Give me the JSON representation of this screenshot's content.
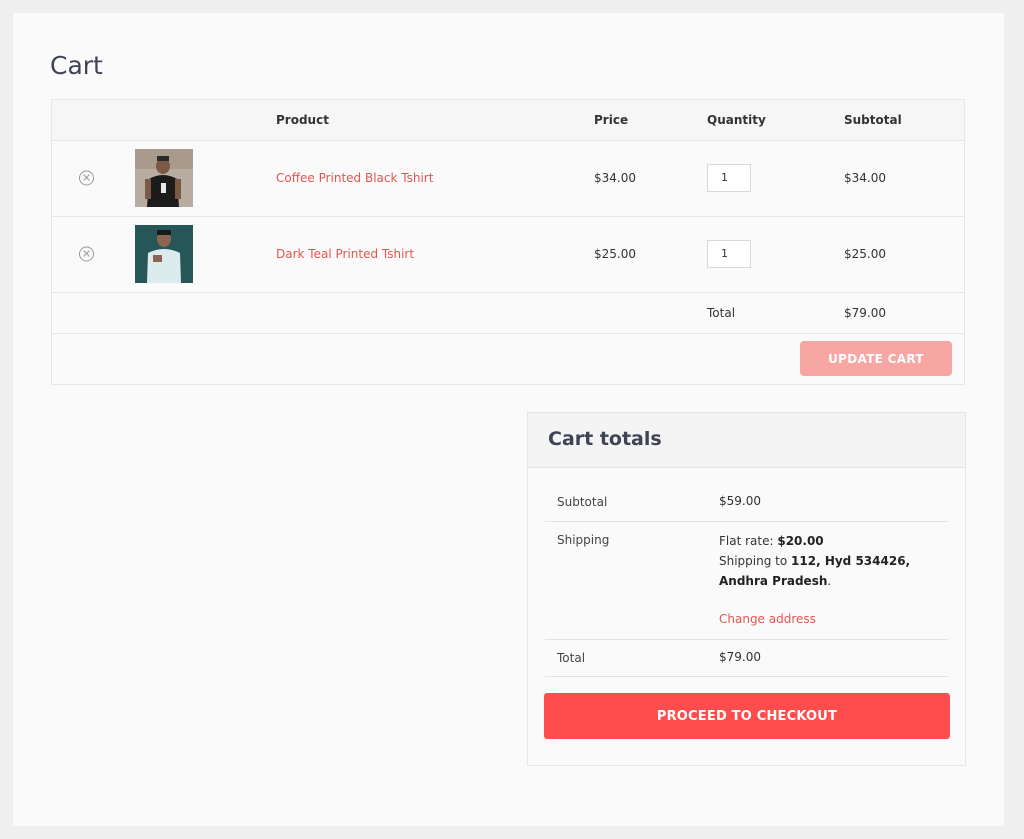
{
  "page": {
    "title": "Cart"
  },
  "table": {
    "headers": {
      "product": "Product",
      "price": "Price",
      "quantity": "Quantity",
      "subtotal": "Subtotal"
    },
    "items": [
      {
        "name": "Coffee Printed Black Tshirt",
        "price": "$34.00",
        "quantity": "1",
        "subtotal": "$34.00",
        "remove_icon": "close-circle-icon"
      },
      {
        "name": "Dark Teal Printed Tshirt",
        "price": "$25.00",
        "quantity": "1",
        "subtotal": "$25.00",
        "remove_icon": "close-circle-icon"
      }
    ],
    "total_label": "Total",
    "total_value": "$79.00",
    "update_label": "UPDATE CART"
  },
  "totals": {
    "title": "Cart totals",
    "subtotal_label": "Subtotal",
    "subtotal_value": "$59.00",
    "shipping_label": "Shipping",
    "shipping_rate_label": "Flat rate: ",
    "shipping_rate_value": "$20.00",
    "shipping_to_label": "Shipping to ",
    "shipping_address_line1": "112, Hyd 534426,",
    "shipping_address_line2": "Andhra Pradesh",
    "change_address": "Change address",
    "total_label": "Total",
    "total_value": "$79.00",
    "checkout_label": "PROCEED TO CHECKOUT"
  },
  "colors": {
    "accent": "#ff4d4d",
    "link": "#e0574f",
    "update_button": "#f7a6a3"
  }
}
